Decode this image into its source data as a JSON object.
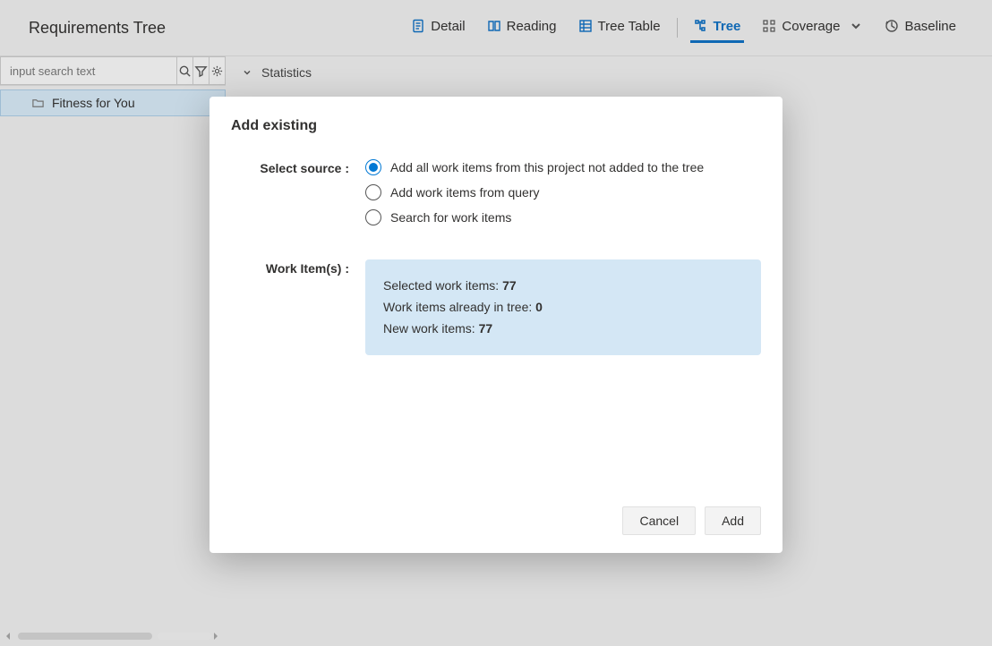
{
  "header": {
    "title": "Requirements Tree",
    "tabs": [
      {
        "label": "Detail",
        "active": false
      },
      {
        "label": "Reading",
        "active": false
      },
      {
        "label": "Tree Table",
        "active": false
      },
      {
        "label": "Tree",
        "active": true
      },
      {
        "label": "Coverage",
        "active": false,
        "dropdown": true
      },
      {
        "label": "Baseline",
        "active": false
      }
    ]
  },
  "search": {
    "placeholder": "input search text"
  },
  "tree": {
    "items": [
      {
        "label": "Fitness for You"
      }
    ]
  },
  "main": {
    "stats_label": "Statistics"
  },
  "modal": {
    "title": "Add existing",
    "source_label": "Select source :",
    "source_options": [
      {
        "label": "Add all work items from this project not added to the tree",
        "selected": true
      },
      {
        "label": "Add work items from query",
        "selected": false
      },
      {
        "label": "Search for work items",
        "selected": false
      }
    ],
    "workitems_label": "Work Item(s) :",
    "summary": {
      "selected_label": "Selected work items:",
      "selected_count": "77",
      "in_tree_label": "Work items already in tree:",
      "in_tree_count": "0",
      "new_label": "New work items:",
      "new_count": "77"
    },
    "buttons": {
      "cancel": "Cancel",
      "add": "Add"
    }
  }
}
